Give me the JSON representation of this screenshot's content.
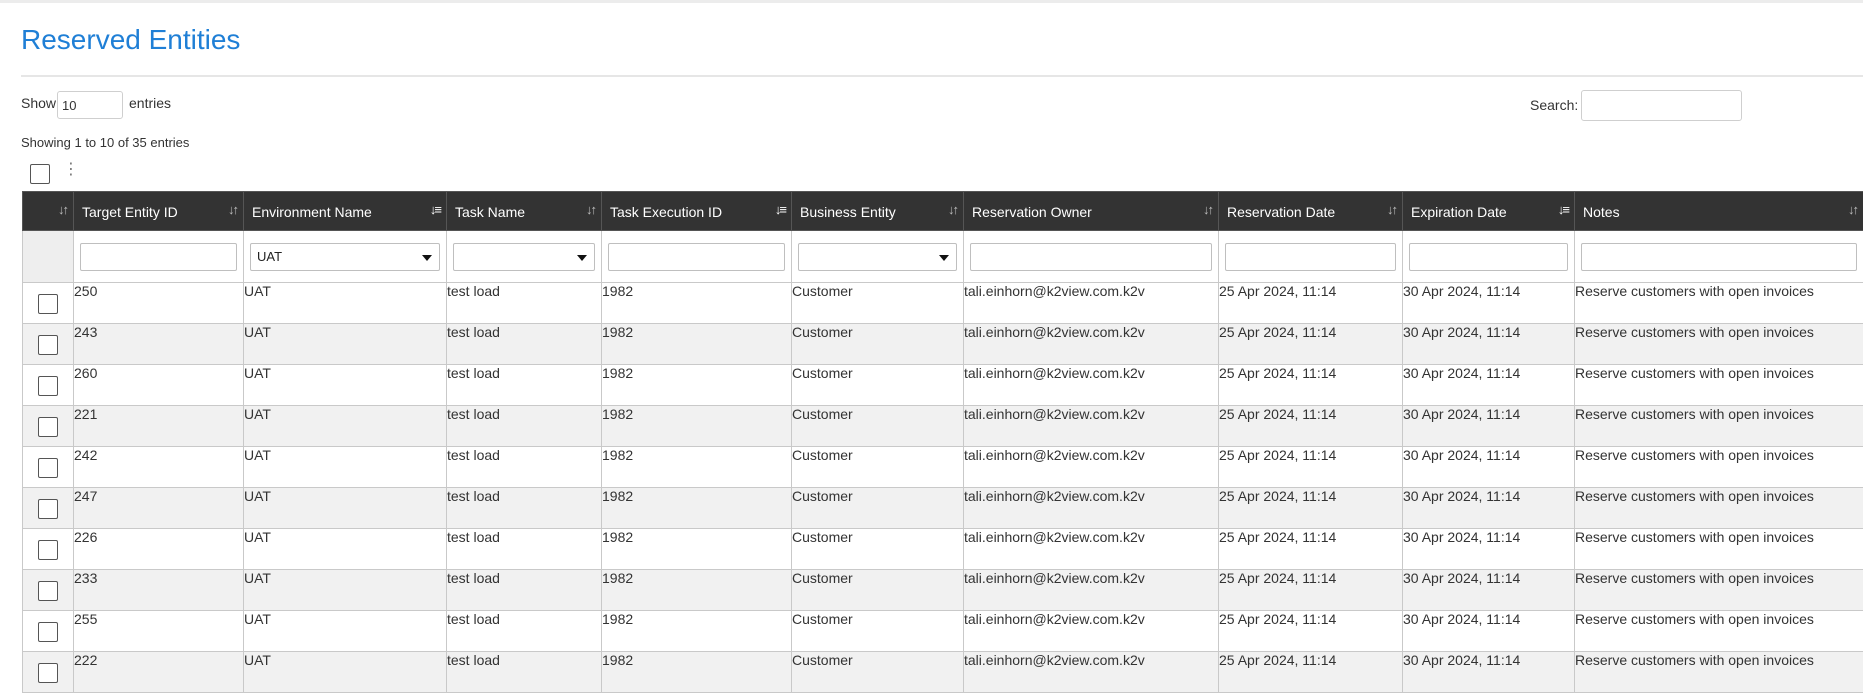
{
  "page": {
    "title": "Reserved Entities",
    "show_label": "Show",
    "page_size": "10",
    "entries_label": "entries",
    "search_label": "Search:",
    "search_value": "",
    "info": "Showing 1 to 10 of 35 entries"
  },
  "icons": {
    "sort": "sort-icon",
    "sort_asc": "sort-ascending-icon",
    "sort_desc": "sort-descending-icon",
    "kebab": "kebab-menu-icon",
    "caret": "chevron-down-icon"
  },
  "colors": {
    "title": "#1f7fd6",
    "header_bg": "#333333",
    "row_alt": "#f1f1f1"
  },
  "table": {
    "columns": [
      {
        "key": "target_entity_id",
        "label": "Target Entity ID",
        "sort": "none"
      },
      {
        "key": "environment_name",
        "label": "Environment Name",
        "sort": "asc"
      },
      {
        "key": "task_name",
        "label": "Task Name",
        "sort": "none"
      },
      {
        "key": "task_execution_id",
        "label": "Task Execution ID",
        "sort": "desc"
      },
      {
        "key": "business_entity",
        "label": "Business Entity",
        "sort": "none"
      },
      {
        "key": "reservation_owner",
        "label": "Reservation Owner",
        "sort": "none"
      },
      {
        "key": "reservation_date",
        "label": "Reservation Date",
        "sort": "none"
      },
      {
        "key": "expiration_date",
        "label": "Expiration Date",
        "sort": "desc"
      },
      {
        "key": "notes",
        "label": "Notes",
        "sort": "none"
      }
    ],
    "filters": {
      "target_entity_id": "",
      "environment_name": "UAT",
      "task_name": "",
      "task_execution_id": "",
      "business_entity": "",
      "reservation_owner": "",
      "reservation_date": "",
      "expiration_date": "",
      "notes": ""
    },
    "rows": [
      {
        "target_entity_id": "250",
        "environment_name": "UAT",
        "task_name": "test load",
        "task_execution_id": "1982",
        "business_entity": "Customer",
        "reservation_owner": "tali.einhorn@k2view.com.k2v",
        "reservation_date": "25 Apr 2024, 11:14",
        "expiration_date": "30 Apr 2024, 11:14",
        "notes": "Reserve customers with open invoices"
      },
      {
        "target_entity_id": "243",
        "environment_name": "UAT",
        "task_name": "test load",
        "task_execution_id": "1982",
        "business_entity": "Customer",
        "reservation_owner": "tali.einhorn@k2view.com.k2v",
        "reservation_date": "25 Apr 2024, 11:14",
        "expiration_date": "30 Apr 2024, 11:14",
        "notes": "Reserve customers with open invoices"
      },
      {
        "target_entity_id": "260",
        "environment_name": "UAT",
        "task_name": "test load",
        "task_execution_id": "1982",
        "business_entity": "Customer",
        "reservation_owner": "tali.einhorn@k2view.com.k2v",
        "reservation_date": "25 Apr 2024, 11:14",
        "expiration_date": "30 Apr 2024, 11:14",
        "notes": "Reserve customers with open invoices"
      },
      {
        "target_entity_id": "221",
        "environment_name": "UAT",
        "task_name": "test load",
        "task_execution_id": "1982",
        "business_entity": "Customer",
        "reservation_owner": "tali.einhorn@k2view.com.k2v",
        "reservation_date": "25 Apr 2024, 11:14",
        "expiration_date": "30 Apr 2024, 11:14",
        "notes": "Reserve customers with open invoices"
      },
      {
        "target_entity_id": "242",
        "environment_name": "UAT",
        "task_name": "test load",
        "task_execution_id": "1982",
        "business_entity": "Customer",
        "reservation_owner": "tali.einhorn@k2view.com.k2v",
        "reservation_date": "25 Apr 2024, 11:14",
        "expiration_date": "30 Apr 2024, 11:14",
        "notes": "Reserve customers with open invoices"
      },
      {
        "target_entity_id": "247",
        "environment_name": "UAT",
        "task_name": "test load",
        "task_execution_id": "1982",
        "business_entity": "Customer",
        "reservation_owner": "tali.einhorn@k2view.com.k2v",
        "reservation_date": "25 Apr 2024, 11:14",
        "expiration_date": "30 Apr 2024, 11:14",
        "notes": "Reserve customers with open invoices"
      },
      {
        "target_entity_id": "226",
        "environment_name": "UAT",
        "task_name": "test load",
        "task_execution_id": "1982",
        "business_entity": "Customer",
        "reservation_owner": "tali.einhorn@k2view.com.k2v",
        "reservation_date": "25 Apr 2024, 11:14",
        "expiration_date": "30 Apr 2024, 11:14",
        "notes": "Reserve customers with open invoices"
      },
      {
        "target_entity_id": "233",
        "environment_name": "UAT",
        "task_name": "test load",
        "task_execution_id": "1982",
        "business_entity": "Customer",
        "reservation_owner": "tali.einhorn@k2view.com.k2v",
        "reservation_date": "25 Apr 2024, 11:14",
        "expiration_date": "30 Apr 2024, 11:14",
        "notes": "Reserve customers with open invoices"
      },
      {
        "target_entity_id": "255",
        "environment_name": "UAT",
        "task_name": "test load",
        "task_execution_id": "1982",
        "business_entity": "Customer",
        "reservation_owner": "tali.einhorn@k2view.com.k2v",
        "reservation_date": "25 Apr 2024, 11:14",
        "expiration_date": "30 Apr 2024, 11:14",
        "notes": "Reserve customers with open invoices"
      },
      {
        "target_entity_id": "222",
        "environment_name": "UAT",
        "task_name": "test load",
        "task_execution_id": "1982",
        "business_entity": "Customer",
        "reservation_owner": "tali.einhorn@k2view.com.k2v",
        "reservation_date": "25 Apr 2024, 11:14",
        "expiration_date": "30 Apr 2024, 11:14",
        "notes": "Reserve customers with open invoices"
      }
    ]
  }
}
